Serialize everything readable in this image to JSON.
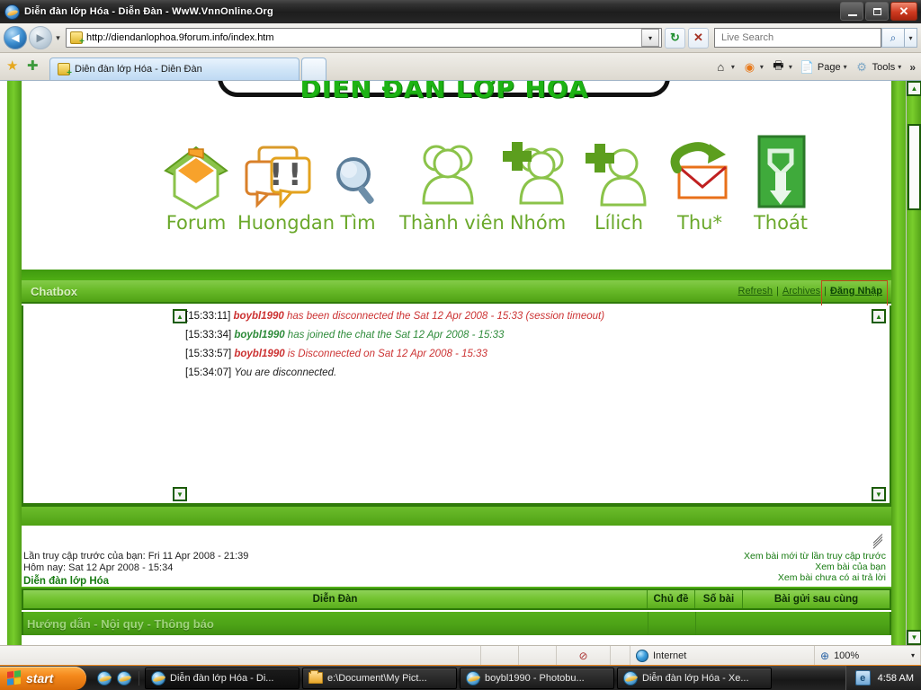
{
  "window": {
    "title": "Diễn đàn lớp Hóa - Diễn Đàn - WwW.VnnOnline.Org",
    "minimize_label": "_",
    "maximize_label": "□",
    "close_label": "✕"
  },
  "browser": {
    "back_label": "◄",
    "forward_label": "►",
    "history_dropdown_label": "▾",
    "address_value": "http://diendanlophoa.9forum.info/index.htm",
    "address_dropdown_label": "▾",
    "refresh_label": "↻",
    "stop_label": "✕",
    "search_placeholder": "Live Search",
    "search_value": "",
    "search_go_label": "⌕",
    "search_dropdown_label": "▾",
    "favorites_label": "★",
    "add_favorite_label": "✚",
    "tabs": [
      {
        "label": "Diễn đàn lớp Hóa - Diễn Đàn"
      }
    ],
    "new_tab_label": "",
    "commands": [
      {
        "label": "",
        "icon": "home-icon",
        "glyph": "⌂",
        "has_arrow": true
      },
      {
        "label": "",
        "icon": "rss-icon",
        "glyph": "◉",
        "has_arrow": true
      },
      {
        "label": "",
        "icon": "print-icon",
        "glyph": "🖶",
        "has_arrow": true
      },
      {
        "label": "Page",
        "icon": "page-icon",
        "glyph": "📄",
        "has_arrow": true
      },
      {
        "label": "Tools",
        "icon": "gear-icon",
        "glyph": "⚙",
        "has_arrow": true
      }
    ],
    "overflow_label": "»"
  },
  "page": {
    "logo_text": "DIỄN ĐÀN LỚP HÓA",
    "nav_icons": [
      {
        "label": "Forum",
        "icon": "house-icon"
      },
      {
        "label": "Huongdan",
        "icon": "speech-bubbles-icon"
      },
      {
        "label": "Tìm",
        "icon": "magnifier-icon"
      },
      {
        "label": "Thành viên",
        "icon": "group-icon"
      },
      {
        "label": "Nhóm",
        "icon": "group-plus-icon"
      },
      {
        "label": "Lílich",
        "icon": "user-plus-icon"
      },
      {
        "label": "Thu*",
        "icon": "mail-icon"
      },
      {
        "label": "Thoát",
        "icon": "exit-icon"
      }
    ],
    "chatbox": {
      "title": "Chatbox",
      "refresh_label": "Refresh",
      "archives_label": "Archives",
      "login_label": "Đăng Nhập",
      "separator": "|",
      "scroll_up_label": "▲",
      "scroll_down_label": "▼",
      "messages": [
        {
          "time": "[15:33:11]",
          "nick": "boybl1990",
          "text": " has been disconnected the Sat 12 Apr 2008 - 15:33 (session timeout)",
          "style": "red"
        },
        {
          "time": "[15:33:34]",
          "nick": "boybl1990",
          "text": " has joined the chat the Sat 12 Apr 2008 - 15:33",
          "style": "green"
        },
        {
          "time": "[15:33:57]",
          "nick": "boybl1990",
          "text": " is Disconnected on Sat 12 Apr 2008 - 15:33",
          "style": "red"
        },
        {
          "time": "[15:34:07]",
          "nick": "",
          "text": "You are disconnected.",
          "style": "dark"
        }
      ]
    },
    "last_visit": {
      "previous_visit": "Lần truy cập trước của bạn: Fri 11 Apr 2008 - 21:39",
      "today": "Hôm nay: Sat 12 Apr 2008 - 15:34",
      "forum_name": "Diễn đàn lớp Hóa",
      "links": [
        "Xem bài mới từ lần truy cập trước",
        "Xem bài của bạn",
        "Xem bài chưa có ai trả lời"
      ]
    },
    "forum_table": {
      "columns": [
        "Diễn Đàn",
        "Chủ đề",
        "Số bài",
        "Bài gửi sau cùng"
      ],
      "rows": [
        {
          "category": "Hướng dẫn - Nội quy - Thông báo"
        }
      ]
    },
    "scrollbar": {
      "up_label": "▲",
      "down_label": "▼"
    }
  },
  "statusbar": {
    "phishing_label": "⊘",
    "zone_label": "Internet",
    "zoom_label": "100%",
    "zoom_dropdown_label": "▾",
    "magnifier_label": "⊕"
  },
  "taskbar": {
    "start_label": "start",
    "quick_launch": [
      {
        "icon": "ie-icon"
      },
      {
        "icon": "ie-icon-2"
      }
    ],
    "tasks": [
      {
        "label": "Diễn đàn lớp Hóa - Di...",
        "icon": "ie-icon",
        "active": true
      },
      {
        "label": "e:\\Document\\My Pict...",
        "icon": "folder-icon",
        "active": false
      },
      {
        "label": "boybl1990 - Photobu...",
        "icon": "ie-icon",
        "active": false
      },
      {
        "label": "Diễn đàn lớp Hóa - Xe...",
        "icon": "ie-icon",
        "active": false
      }
    ],
    "tray_icon_label": "e",
    "clock": "4:58 AM"
  }
}
